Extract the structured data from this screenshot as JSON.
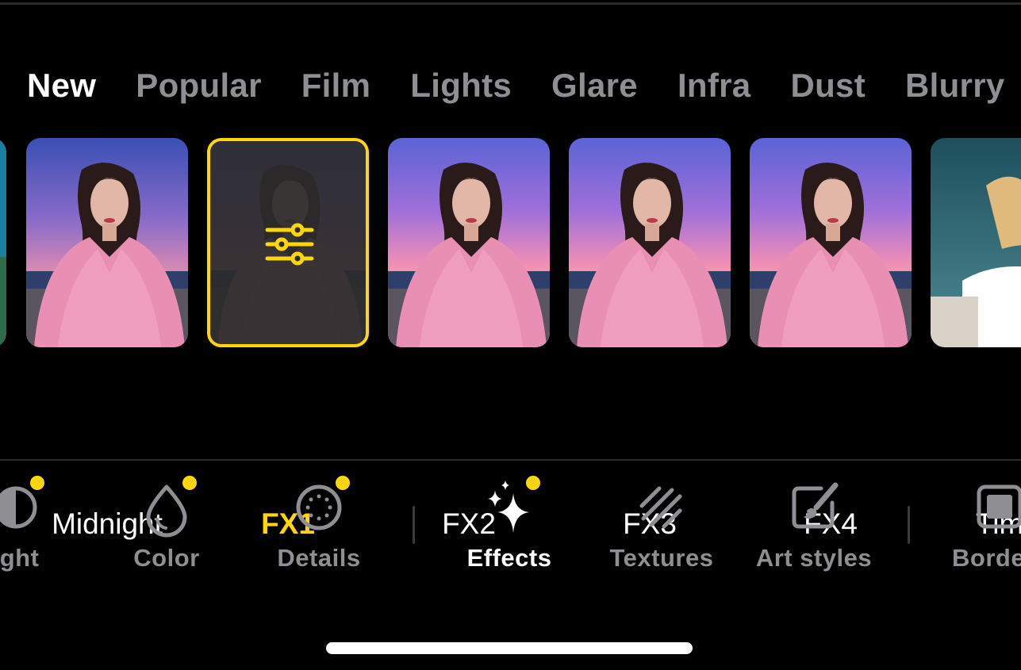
{
  "categories": {
    "tabs": [
      {
        "label": "New",
        "active": true
      },
      {
        "label": "Popular",
        "active": false
      },
      {
        "label": "Film",
        "active": false
      },
      {
        "label": "Lights",
        "active": false
      },
      {
        "label": "Glare",
        "active": false
      },
      {
        "label": "Infra",
        "active": false
      },
      {
        "label": "Dust",
        "active": false
      },
      {
        "label": "Blurry",
        "active": false
      }
    ]
  },
  "filters": {
    "items": [
      {
        "label": "Midnight",
        "selected": false
      },
      {
        "label": "FX1",
        "selected": true,
        "icon": "sliders-icon"
      },
      {
        "label": "FX2",
        "selected": false
      },
      {
        "label": "FX3",
        "selected": false
      },
      {
        "label": "FX4",
        "selected": false
      },
      {
        "label": "Tim",
        "selected": false
      }
    ]
  },
  "toolbar": {
    "items": [
      {
        "label": "ight",
        "icon": "light-half-circle-icon",
        "badge": true,
        "active": false
      },
      {
        "label": "Color",
        "icon": "drop-icon",
        "badge": true,
        "active": false
      },
      {
        "label": "Details",
        "icon": "dotted-circle-icon",
        "badge": true,
        "active": false
      },
      {
        "label": "Effects",
        "icon": "sparkles-icon",
        "badge": true,
        "active": true
      },
      {
        "label": "Textures",
        "icon": "diagonal-lines-icon",
        "badge": false,
        "active": false
      },
      {
        "label": "Art styles",
        "icon": "brush-square-icon",
        "badge": false,
        "active": false
      },
      {
        "label": "Borde",
        "icon": "border-square-icon",
        "badge": false,
        "active": false
      }
    ]
  },
  "colors": {
    "accent": "#ffd60a",
    "active_text": "#ffffff",
    "inactive_text": "#8e8e93",
    "background": "#000000"
  }
}
